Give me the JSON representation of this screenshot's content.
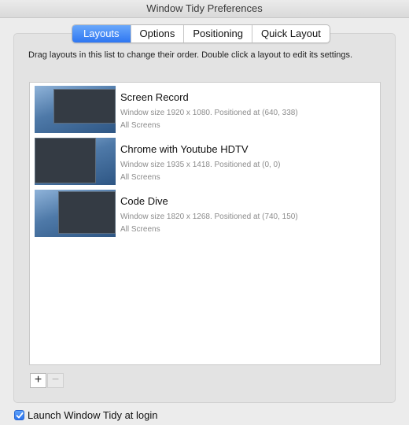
{
  "window": {
    "title": "Window Tidy Preferences"
  },
  "tabs": [
    {
      "label": "Layouts",
      "active": true
    },
    {
      "label": "Options",
      "active": false
    },
    {
      "label": "Positioning",
      "active": false
    },
    {
      "label": "Quick Layout",
      "active": false
    }
  ],
  "hint": "Drag layouts in this list to change their order. Double click a layout to edit its settings.",
  "layouts": [
    {
      "name": "Screen Record",
      "details": "Window size 1920 x 1080. Positioned at (640, 338)",
      "screens": "All Screens"
    },
    {
      "name": "Chrome with Youtube HDTV",
      "details": "Window size 1935 x 1418. Positioned at (0, 0)",
      "screens": "All Screens"
    },
    {
      "name": "Code Dive",
      "details": "Window size 1820 x 1268. Positioned at (740, 150)",
      "screens": "All Screens"
    }
  ],
  "buttons": {
    "add": "+",
    "remove": "−"
  },
  "launch_at_login": {
    "label": "Launch Window Tidy at login",
    "checked": true
  },
  "colors": {
    "accent": "#2e76f1",
    "thumbnail_bg": "#4e79a8",
    "window_dark": "#343b44"
  },
  "icons": {
    "add": "plus-icon",
    "remove": "minus-icon",
    "checkbox": "checkmark-icon"
  }
}
